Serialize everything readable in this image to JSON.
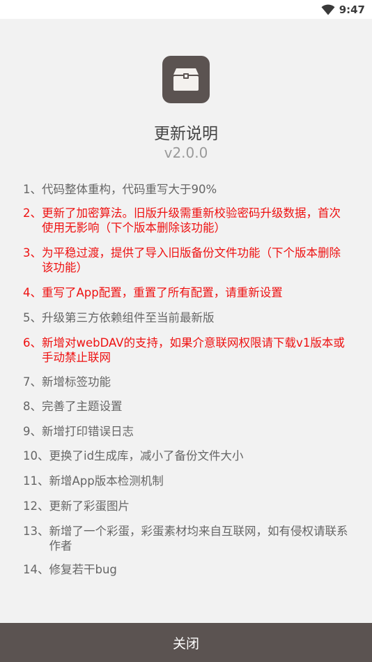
{
  "status_bar": {
    "time": "9:47",
    "wifi_icon": "wifi-icon"
  },
  "app_icon": "toolbox-icon",
  "title": "更新说明",
  "version": "v2.0.0",
  "changes": [
    {
      "num": "1、",
      "text": "代码整体重构，代码重写大于90%",
      "highlight": false
    },
    {
      "num": "2、",
      "text": "更新了加密算法。旧版升级需重新校验密码升级数据，首次使用无影响（下个版本删除该功能）",
      "highlight": true
    },
    {
      "num": "3、",
      "text": "为平稳过渡，提供了导入旧版备份文件功能（下个版本删除该功能）",
      "highlight": true
    },
    {
      "num": "4、",
      "text": "重写了App配置，重置了所有配置，请重新设置",
      "highlight": true
    },
    {
      "num": "5、",
      "text": "升级第三方依赖组件至当前最新版",
      "highlight": false
    },
    {
      "num": "6、",
      "text": "新增对webDAV的支持，如果介意联网权限请下载v1版本或手动禁止联网",
      "highlight": true
    },
    {
      "num": "7、",
      "text": "新增标签功能",
      "highlight": false
    },
    {
      "num": "8、",
      "text": "完善了主题设置",
      "highlight": false
    },
    {
      "num": "9、",
      "text": "新增打印错误日志",
      "highlight": false
    },
    {
      "num": "10、",
      "text": "更换了id生成库，减小了备份文件大小",
      "highlight": false
    },
    {
      "num": "11、",
      "text": "新增App版本检测机制",
      "highlight": false
    },
    {
      "num": "12、",
      "text": "更新了彩蛋图片",
      "highlight": false
    },
    {
      "num": "13、",
      "text": "新增了一个彩蛋，彩蛋素材均来自互联网，如有侵权请联系作者",
      "highlight": false
    },
    {
      "num": "14、",
      "text": "修复若干bug",
      "highlight": false
    }
  ],
  "close_button": "关闭",
  "colors": {
    "highlight": "#ee1111",
    "normal_text": "#666666",
    "bar": "#5b5351",
    "background": "#f2f2f2"
  }
}
